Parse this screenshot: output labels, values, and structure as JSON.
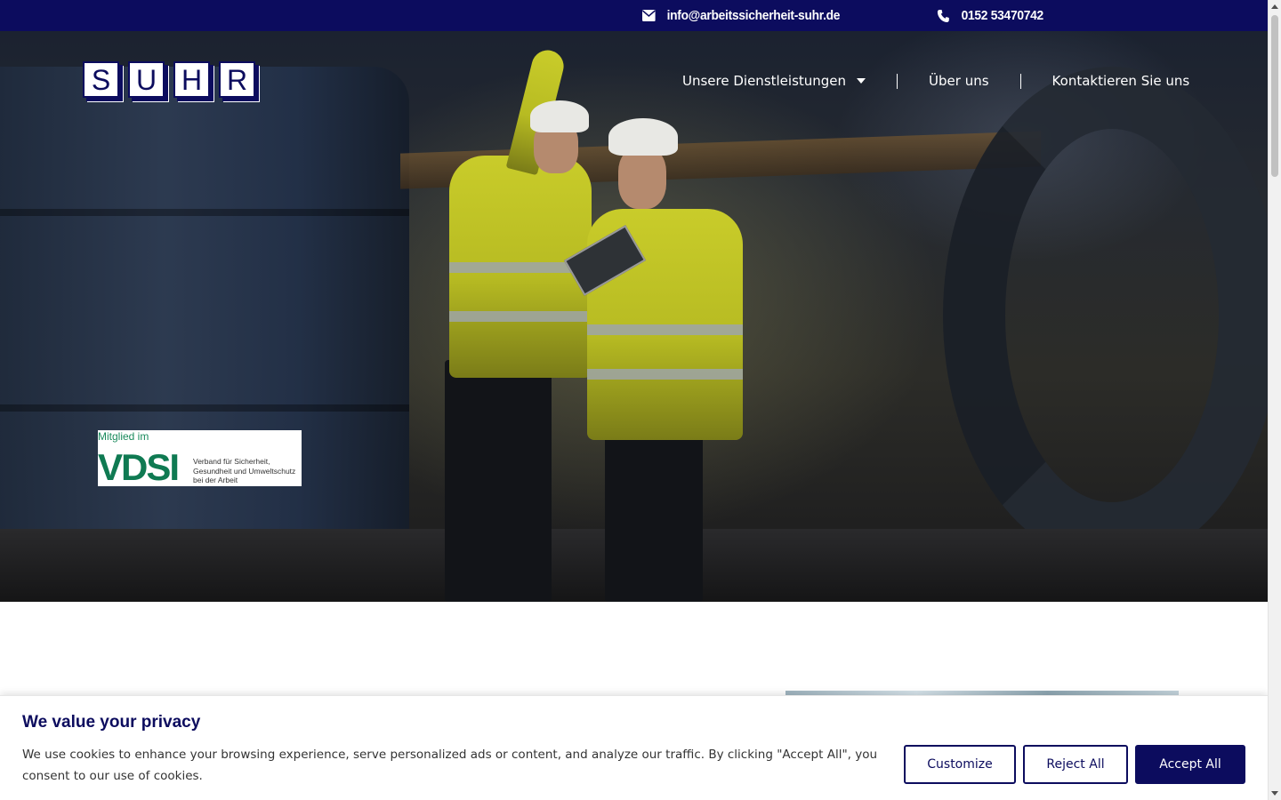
{
  "topbar": {
    "email": "info@arbeitssicherheit-suhr.de",
    "phone": "0152 53470742",
    "email_icon": "envelope-icon",
    "phone_icon": "phone-icon"
  },
  "logo": {
    "letters": [
      "S",
      "U",
      "H",
      "R"
    ]
  },
  "nav": {
    "items": [
      {
        "label": "Unsere Dienstleistungen",
        "has_dropdown": true
      },
      {
        "label": "Über uns"
      },
      {
        "label": "Kontaktieren Sie uns"
      }
    ]
  },
  "badge": {
    "member_text": "Mitglied im",
    "acronym": "VDSI",
    "description": "Verband für Sicherheit, Gesundheit und Umweltschutz bei der Arbeit"
  },
  "cookie": {
    "title": "We value your privacy",
    "text": "We use cookies to enhance your browsing experience, serve personalized ads or content, and analyze our traffic. By clicking \"Accept All\", you consent to our use of cookies.",
    "customize_label": "Customize",
    "reject_label": "Reject All",
    "accept_label": "Accept All"
  },
  "colors": {
    "brand_navy": "#0c0c5e",
    "vdsi_green": "#0f7a52"
  }
}
